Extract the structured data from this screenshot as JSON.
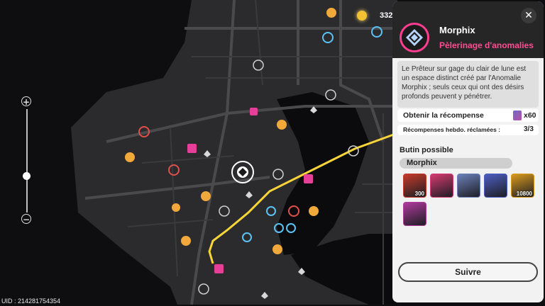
{
  "header": {
    "currency_value": "332"
  },
  "map": {
    "uid_label": "UID : 214281754354"
  },
  "zoom": {
    "plus_label": "+",
    "minus_label": "−"
  },
  "panel": {
    "close_label": "✕",
    "name": "Morphix",
    "subtitle": "Pèlerinage d'anomalies",
    "description": "Le Prêteur sur gage du clair de lune est un espace distinct créé par l'Anomalie Morphix ; seuls ceux qui ont des désirs profonds peuvent y pénétrer.",
    "reward": {
      "label": "Obtenir la récompense",
      "amount": "x60"
    },
    "weekly": {
      "label": "Récompenses hebdo. réclamées :",
      "value": "3/3"
    },
    "loot_title": "Butin possible",
    "loot_filter": "Morphix",
    "items": [
      {
        "name": "reroll-item",
        "quantity": "300",
        "color": "#c43a2a"
      },
      {
        "name": "pink-core-item",
        "quantity": "",
        "color": "#d4396f"
      },
      {
        "name": "card-pack-item",
        "quantity": "",
        "color": "#6b7fb8"
      },
      {
        "name": "tube-item",
        "quantity": "",
        "color": "#4c5ec0"
      },
      {
        "name": "gold-coin-item",
        "quantity": "10800",
        "color": "#d99a1d"
      },
      {
        "name": "cannon-item",
        "quantity": "",
        "color": "#b03a9c"
      }
    ],
    "follow_label": "Suivre"
  },
  "colors": {
    "accent": "#ff4c93",
    "route": "#f7d53a",
    "map_bg": "#0e0e10",
    "land": "#2b2b2d"
  }
}
